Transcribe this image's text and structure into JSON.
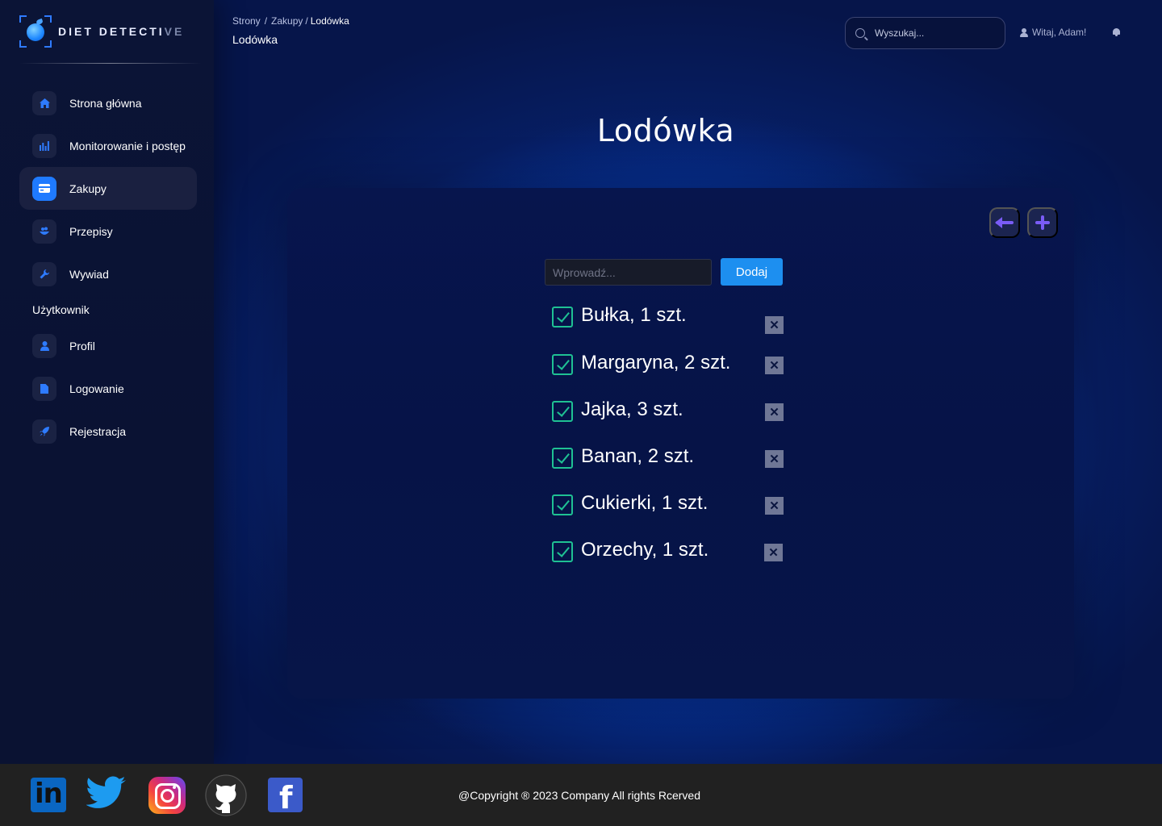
{
  "brand": {
    "name_main": "DIET DETECTI",
    "name_fade": "VE"
  },
  "sidebar": {
    "items": [
      {
        "label": "Strona główna",
        "icon": "home-icon"
      },
      {
        "label": "Monitorowanie i postęp",
        "icon": "chart-icon"
      },
      {
        "label": "Zakupy",
        "icon": "card-icon",
        "active": true
      },
      {
        "label": "Przepisy",
        "icon": "recipes-icon"
      },
      {
        "label": "Wywiad",
        "icon": "wrench-icon"
      }
    ],
    "section_label": "Użytkownik",
    "user_items": [
      {
        "label": "Profil",
        "icon": "user-icon"
      },
      {
        "label": "Logowanie",
        "icon": "document-icon"
      },
      {
        "label": "Rejestracja",
        "icon": "rocket-icon"
      }
    ]
  },
  "header": {
    "breadcrumb": [
      "Strony",
      "Zakupy",
      "Lodówka"
    ],
    "page_subtitle": "Lodówka",
    "search_placeholder": "Wyszukaj...",
    "greeting": "Witaj, Adam!"
  },
  "main": {
    "title": "Lodówka",
    "input_placeholder": "Wprowadź...",
    "add_button": "Dodaj",
    "items": [
      {
        "label": "Bułka, 1 szt.",
        "checked": true
      },
      {
        "label": "Margaryna, 2 szt.",
        "checked": true
      },
      {
        "label": "Jajka, 3 szt.",
        "checked": true
      },
      {
        "label": "Banan, 2 szt.",
        "checked": true
      },
      {
        "label": "Cukierki, 1 szt.",
        "checked": true
      },
      {
        "label": "Orzechy, 1 szt.",
        "checked": true
      }
    ],
    "delete_glyph": "✕"
  },
  "footer": {
    "social": [
      "linkedin-icon",
      "twitter-icon",
      "instagram-icon",
      "github-icon",
      "facebook-icon"
    ],
    "linkedin_text": "in",
    "facebook_text": "f",
    "copyright": "@Copyright ® 2023 Company All rights Rcerved"
  },
  "colors": {
    "accent": "#1f7aff",
    "check": "#1fc193",
    "purple": "#7a5cf5",
    "button": "#1d8ff0"
  }
}
